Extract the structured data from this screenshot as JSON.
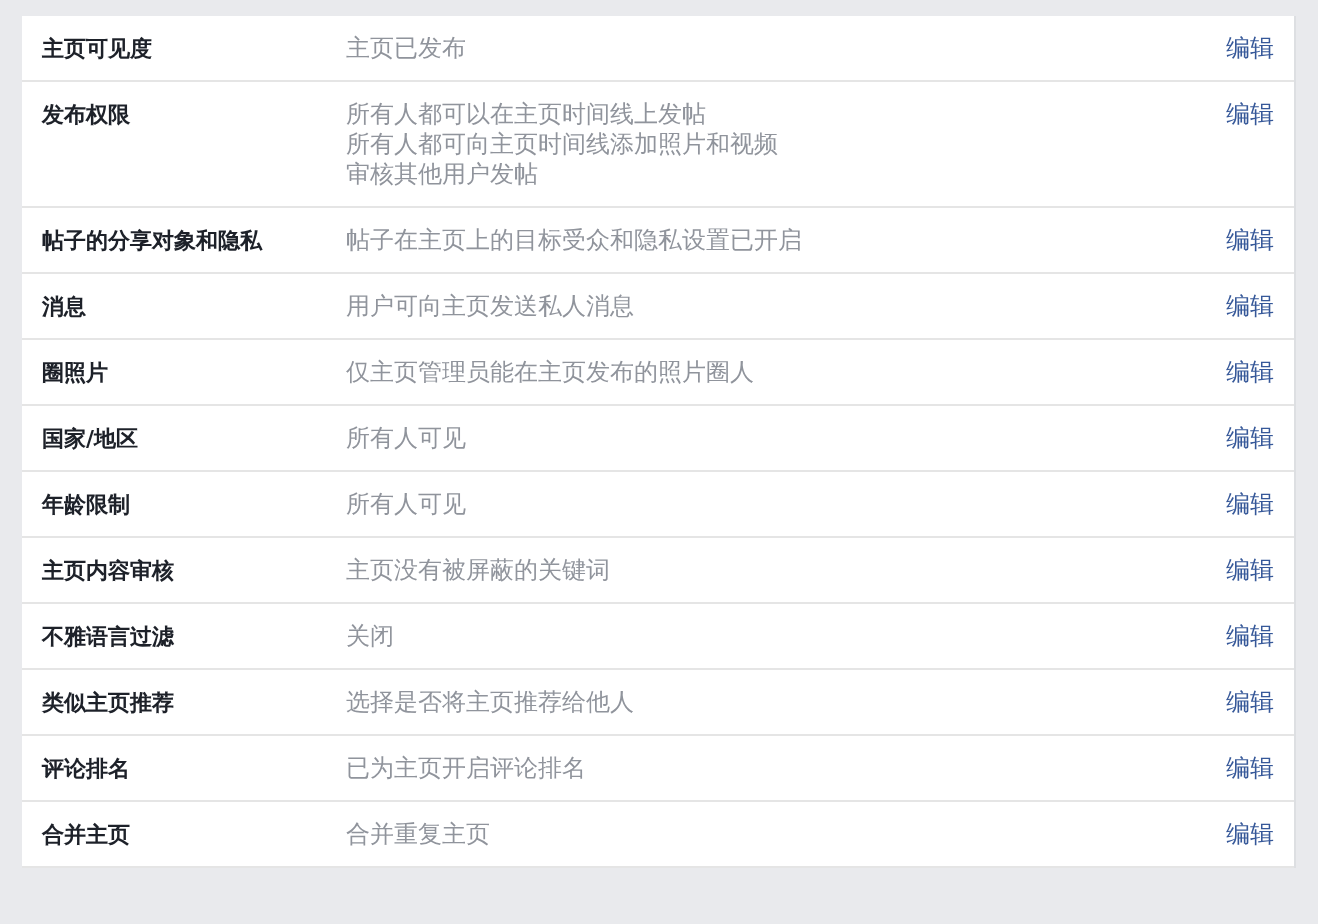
{
  "settings": [
    {
      "label": "主页可见度",
      "values": [
        "主页已发布"
      ],
      "action": "编辑"
    },
    {
      "label": "发布权限",
      "values": [
        "所有人都可以在主页时间线上发帖",
        "所有人都可向主页时间线添加照片和视频",
        "审核其他用户发帖"
      ],
      "action": "编辑"
    },
    {
      "label": "帖子的分享对象和隐私",
      "values": [
        "帖子在主页上的目标受众和隐私设置已开启"
      ],
      "action": "编辑"
    },
    {
      "label": "消息",
      "values": [
        "用户可向主页发送私人消息"
      ],
      "action": "编辑"
    },
    {
      "label": "圈照片",
      "values": [
        "仅主页管理员能在主页发布的照片圈人"
      ],
      "action": "编辑"
    },
    {
      "label": "国家/地区",
      "values": [
        "所有人可见"
      ],
      "action": "编辑"
    },
    {
      "label": "年龄限制",
      "values": [
        "所有人可见"
      ],
      "action": "编辑"
    },
    {
      "label": "主页内容审核",
      "values": [
        "主页没有被屏蔽的关键词"
      ],
      "action": "编辑"
    },
    {
      "label": "不雅语言过滤",
      "values": [
        "关闭"
      ],
      "action": "编辑"
    },
    {
      "label": "类似主页推荐",
      "values": [
        "选择是否将主页推荐给他人"
      ],
      "action": "编辑"
    },
    {
      "label": "评论排名",
      "values": [
        "已为主页开启评论排名"
      ],
      "action": "编辑"
    },
    {
      "label": "合并主页",
      "values": [
        "合并重复主页"
      ],
      "action": "编辑"
    }
  ]
}
